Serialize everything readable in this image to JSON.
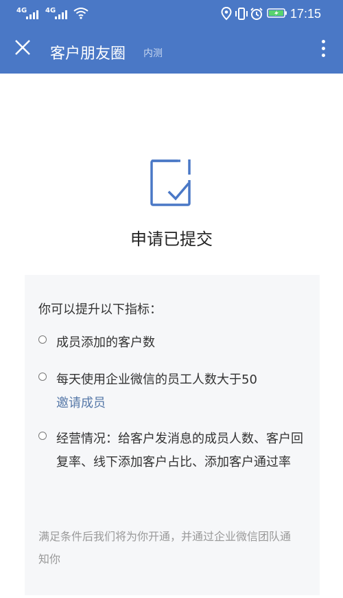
{
  "status_bar": {
    "network_1": "4G",
    "network_2": "4G",
    "time": "17:15"
  },
  "navbar": {
    "title": "客户朋友圈",
    "badge": "内测"
  },
  "result": {
    "title": "申请已提交"
  },
  "card": {
    "heading": "你可以提升以下指标：",
    "items": [
      {
        "text": "成员添加的客户数"
      },
      {
        "text": "每天使用企业微信的员工人数大于50",
        "link": "邀请成员"
      },
      {
        "text": "经营情况：给客户发消息的成员人数、客户回复率、线下添加客户占比、添加客户通过率"
      }
    ],
    "footnote": "满足条件后我们将为你开通，并通过企业微信团队通知你"
  },
  "colors": {
    "header_bg": "#4a78c6",
    "accent": "#4a78c6",
    "link": "#5678a8"
  }
}
